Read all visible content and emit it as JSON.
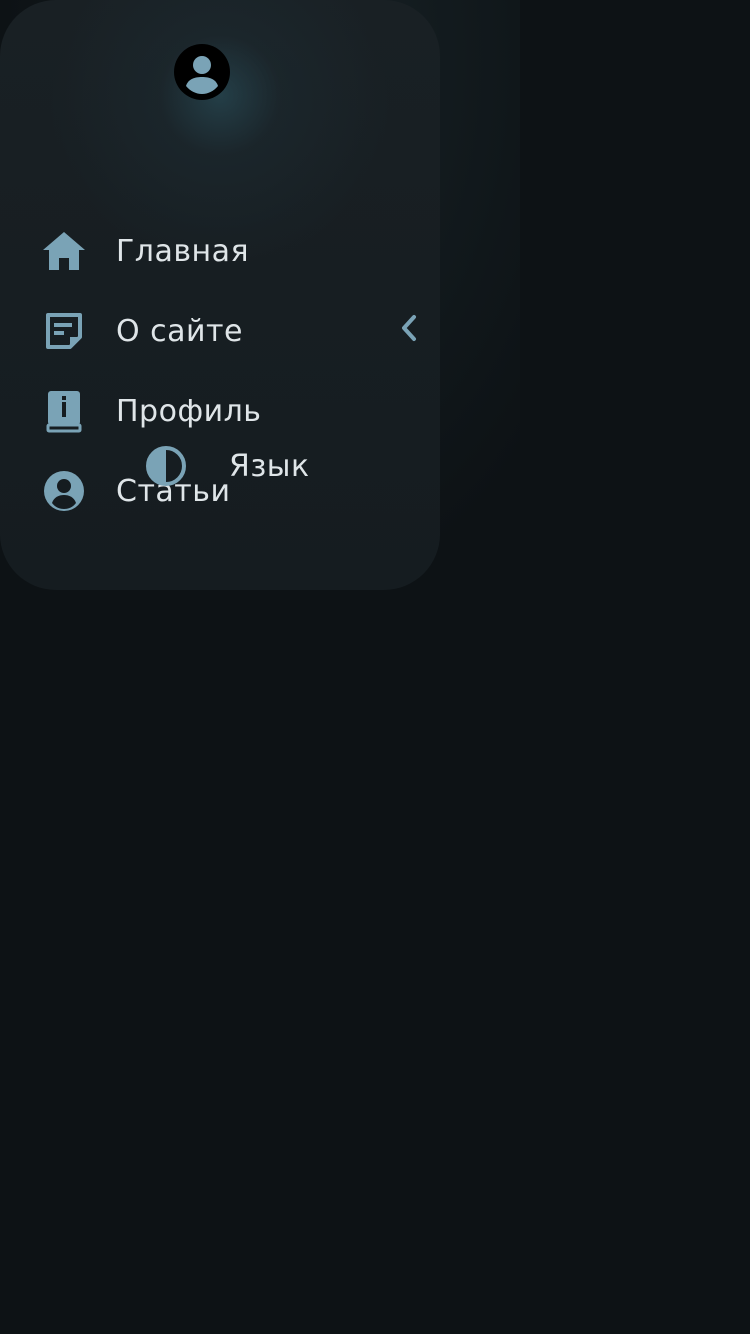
{
  "colors": {
    "background": "#0d1215",
    "drawer": "#192024",
    "icon": "#7aa3b6",
    "text": "#dfe5e8",
    "avatar": "#000000"
  },
  "drawer": {
    "avatar_icon": "account-circle-icon",
    "items": [
      {
        "label": "Главная",
        "icon": "home-icon"
      },
      {
        "label": "О сайте",
        "icon": "note-icon",
        "trailing_icon": "chevron-left-icon"
      },
      {
        "label": "Профиль",
        "icon": "info-book-icon"
      },
      {
        "label": "Статьи",
        "icon": "account-circle-icon"
      }
    ],
    "language": {
      "label": "Язык",
      "icon": "contrast-icon"
    }
  }
}
